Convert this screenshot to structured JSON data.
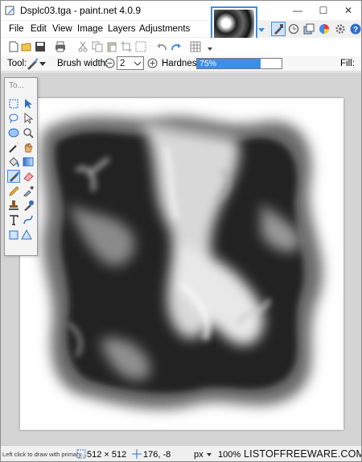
{
  "window": {
    "title": "Dsplc03.tga - paint.net 4.0.9",
    "controls": [
      "—",
      "☐",
      "✕"
    ]
  },
  "menu": [
    {
      "label": "File"
    },
    {
      "label": "Edit"
    },
    {
      "label": "View"
    },
    {
      "label": "Image"
    },
    {
      "label": "Layers"
    },
    {
      "label": "Adjustments"
    }
  ],
  "tool_options": {
    "tool_label": "Tool:",
    "brush_width_label": "Brush width:",
    "brush_width_value": "2",
    "hardness_label": "Hardness:",
    "hardness_value": "75%",
    "hardness_fraction": 0.75,
    "fill_label": "Fill:"
  },
  "tools_panel": {
    "title": "To..."
  },
  "status": {
    "hint": "Left click to draw with primary...",
    "image_size": "512 × 512",
    "cursor_pos": "176, -8",
    "unit": "px",
    "zoom": "100%"
  },
  "watermark": "LISTOFFREEWARE.COM",
  "colors": {
    "accent": "#3c8ee8",
    "workspace": "#d4d4d4"
  }
}
